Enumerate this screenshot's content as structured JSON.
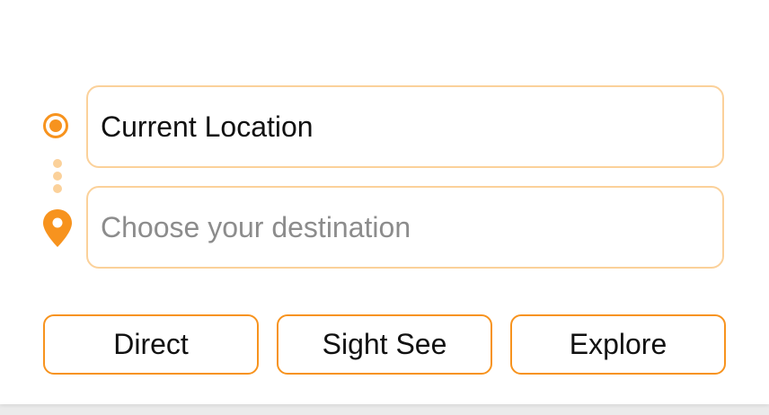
{
  "colors": {
    "accent": "#f7931e",
    "accent_light": "#fbd19a",
    "placeholder": "#8c8c8c",
    "text": "#111111"
  },
  "route": {
    "origin_icon": "origin-radio-icon",
    "connector_icon": "route-dots-icon",
    "destination_icon": "map-pin-icon"
  },
  "origin_field": {
    "value": "Current Location"
  },
  "destination_field": {
    "value": "",
    "placeholder": "Choose your destination"
  },
  "modes": [
    {
      "label": "Direct"
    },
    {
      "label": "Sight See"
    },
    {
      "label": "Explore"
    }
  ]
}
